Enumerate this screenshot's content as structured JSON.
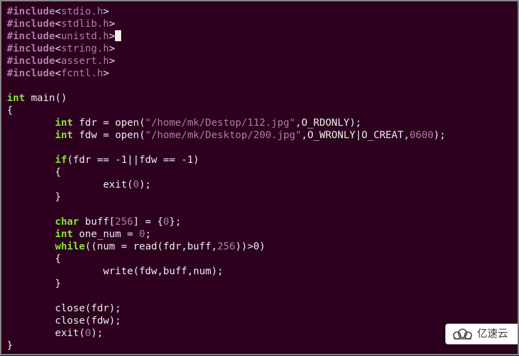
{
  "includes": [
    "stdio.h",
    "stdlib.h",
    "unistd.h",
    "string.h",
    "assert.h",
    "fcntl.h"
  ],
  "cursor_line_index": 2,
  "code": {
    "ret_type": "int",
    "func_name": "main",
    "fdr": {
      "type": "int",
      "name": "fdr",
      "fn": "open",
      "path": "/home/mk/Destop/112.jpg",
      "flags": "O_RDONLY"
    },
    "fdw": {
      "type": "int",
      "name": "fdw",
      "fn": "open",
      "path": "/home/mk/Desktop/200.jpg",
      "flags": "O_WRONLY|O_CREAT",
      "mode": "0600"
    },
    "if_cond": "fdr == -1||fdw == -1",
    "exit_fn": "exit",
    "exit_arg": "0",
    "buf": {
      "type": "char",
      "name": "buff",
      "size": "256",
      "init": "0"
    },
    "one_num": {
      "type": "int",
      "name": "one_num",
      "val": "0"
    },
    "while": {
      "kw": "while",
      "assign": "num",
      "read_fn": "read",
      "args_pre": "fdr,buff,",
      "read_n": "256",
      "cmp": ">0"
    },
    "write": {
      "fn": "write",
      "args": "fdw,buff,num"
    },
    "close": "close",
    "close1": "fdr",
    "close2": "fdw"
  },
  "watermark": "亿速云"
}
